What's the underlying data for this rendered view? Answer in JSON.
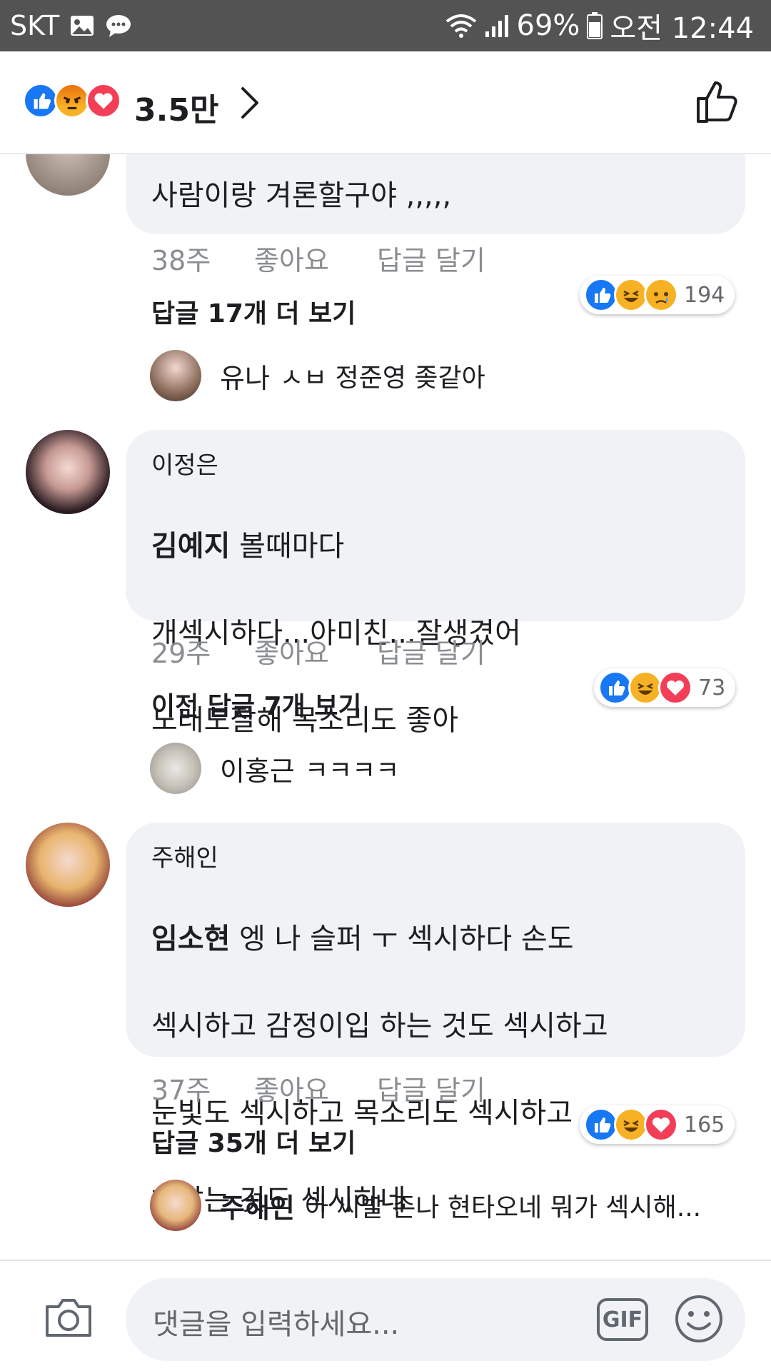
{
  "status_bar": {
    "carrier": "SKT",
    "battery_percent": "69%",
    "time": "오전 12:44",
    "icons": [
      "image-icon",
      "chat-bubble-icon",
      "wifi-icon",
      "signal-icon",
      "battery-icon"
    ]
  },
  "header": {
    "reactions": [
      "like",
      "angry",
      "love"
    ],
    "count": "3.5만"
  },
  "comments": [
    {
      "partial_top_text": "사람이랑 겨론할구야 ,,,,,",
      "time": "38주",
      "like_label": "좋아요",
      "reply_label": "답글 달기",
      "reactions": [
        "like",
        "laugh",
        "sad"
      ],
      "reaction_count": "194",
      "more_replies": "답글 17개 더 보기",
      "reply": {
        "name": "유나",
        "text": "ㅅㅂ 정준영 좆같아"
      }
    },
    {
      "name": "이정은",
      "tagged": "김예지",
      "text_line1": " 볼때마다",
      "text_line2": "개섹시하다...아미친...잘생겼어",
      "text_line3": "노래도잘해 목소리도 좋아",
      "time": "29주",
      "like_label": "좋아요",
      "reply_label": "답글 달기",
      "reactions": [
        "like",
        "laugh",
        "love"
      ],
      "reaction_count": "73",
      "more_replies": "이전 답글 7개 보기",
      "reply": {
        "name": "이홍근",
        "text": "ㅋㅋㅋㅋ"
      }
    },
    {
      "name": "주해인",
      "tagged": "임소현",
      "text_line1": " 엥 나 슬퍼 ㅜ 섹시하다 손도",
      "text_line2": "섹시하고 감정이입 하는 것도 섹시하고",
      "text_line3": "눈빛도 섹시하고 목소리도 섹시하고",
      "text_line4": "혀앓는 것도 섹시하네",
      "time": "37주",
      "like_label": "좋아요",
      "reply_label": "답글 달기",
      "reactions": [
        "like",
        "laugh",
        "love"
      ],
      "reaction_count": "165",
      "more_replies": "답글 35개 더 보기",
      "reply": {
        "name": "주해인",
        "text": "아 씨발 존나 현타오네 뭐가 섹시해..."
      }
    }
  ],
  "composer": {
    "placeholder": "댓글을 입력하세요...",
    "gif_label": "GIF"
  }
}
